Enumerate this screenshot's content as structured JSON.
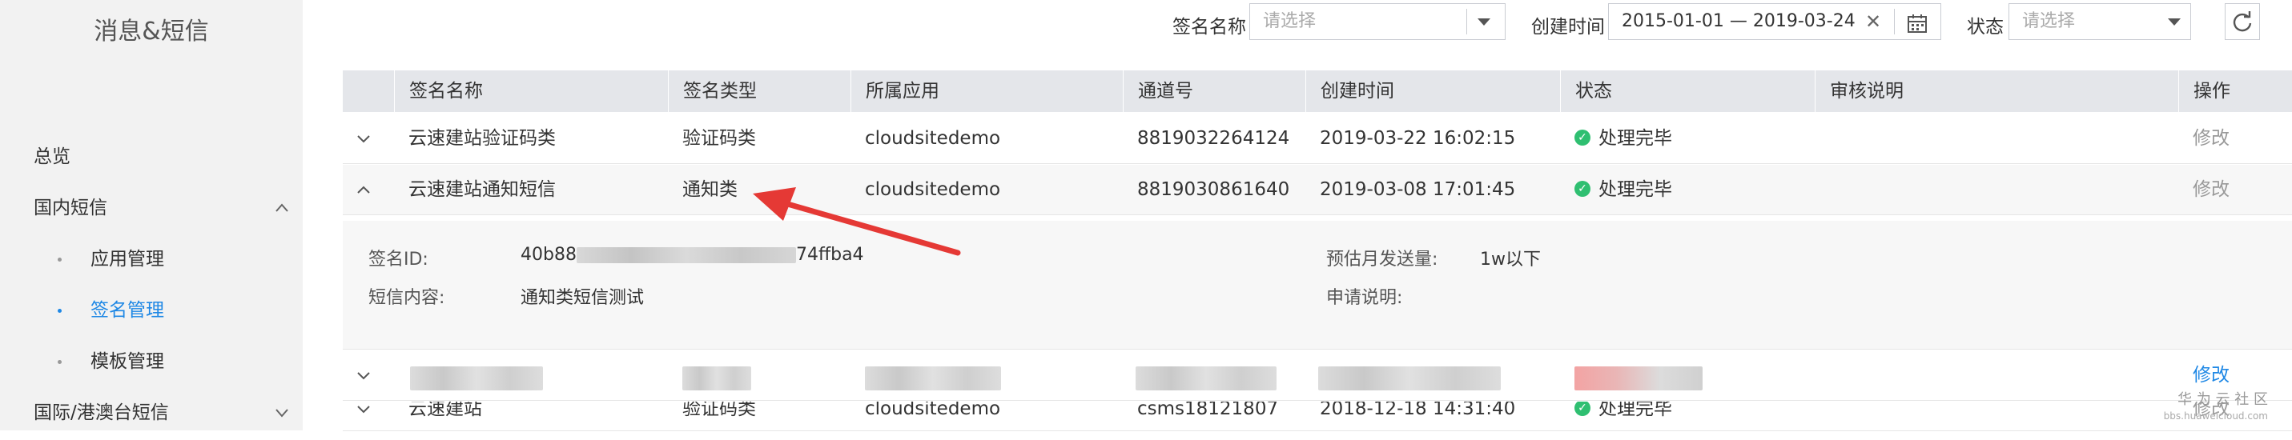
{
  "sidebar": {
    "title": "消息&短信",
    "items": [
      {
        "label": "总览"
      },
      {
        "label": "国内短信",
        "chevron": "up"
      },
      {
        "label": "应用管理"
      },
      {
        "label": "签名管理",
        "active": true
      },
      {
        "label": "模板管理"
      },
      {
        "label": "国际/港澳台短信",
        "chevron": "down"
      }
    ]
  },
  "filters": {
    "sign_name_label": "签名名称",
    "sign_name_placeholder": "请选择",
    "created_label": "创建时间",
    "date_range": "2015-01-01 — 2019-03-24",
    "status_label": "状态",
    "status_placeholder": "请选择"
  },
  "table": {
    "headers": [
      "签名名称",
      "签名类型",
      "所属应用",
      "通道号",
      "创建时间",
      "状态",
      "审核说明",
      "操作"
    ],
    "rows": [
      {
        "name": "云速建站验证码类",
        "type": "验证码类",
        "app": "cloudsitedemo",
        "channel": "8819032264124",
        "created": "2019-03-22 16:02:15",
        "status": "处理完毕",
        "action": "修改"
      },
      {
        "name": "云速建站通知短信",
        "type": "通知类",
        "app": "cloudsitedemo",
        "channel": "8819030861640",
        "created": "2019-03-08 17:01:45",
        "status": "处理完毕",
        "action": "修改"
      },
      {
        "action": "修改"
      },
      {
        "name": "云速建站",
        "type": "验证码类",
        "app": "cloudsitedemo",
        "channel": "csms18121807",
        "created": "2018-12-18 14:31:40",
        "status": "处理完毕",
        "action": "修改"
      }
    ],
    "detail": {
      "sign_id_label": "签名ID:",
      "sign_id_prefix": "40b88",
      "sign_id_suffix": "74ffba4",
      "content_label": "短信内容:",
      "content_value": "通知类短信测试",
      "volume_label": "预估月发送量:",
      "volume_value": "1w以下",
      "apply_label": "申请说明:"
    }
  },
  "watermark": {
    "line1": "华 为 云 社 区",
    "line2": "bbs.huaweicloud.com"
  },
  "colors": {
    "accent": "#1f88e5",
    "success": "#2fbf71",
    "arrow": "#e53935"
  },
  "icons": [
    "chevron-up-icon",
    "chevron-down-icon",
    "calendar-icon",
    "refresh-icon",
    "clear-icon",
    "check-circle-icon"
  ]
}
